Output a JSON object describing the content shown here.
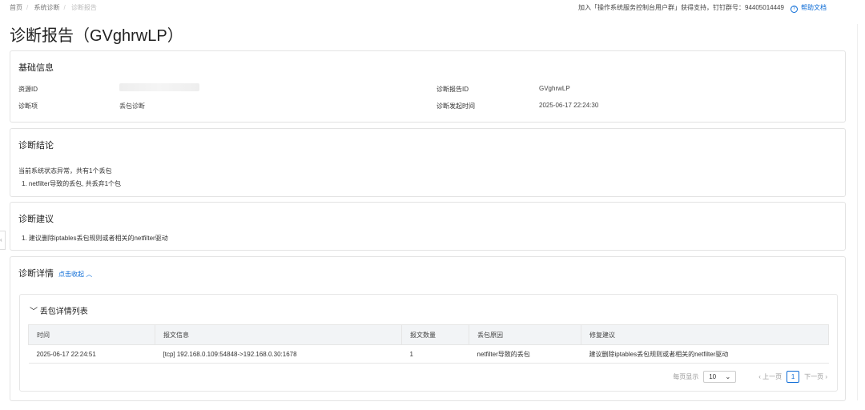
{
  "breadcrumb": [
    "首页",
    "系统诊断",
    "诊断报告"
  ],
  "support": {
    "text": "加入「操作系统服务控制台用户群」获得支持，钉钉群号：94405014449",
    "help": "帮助文档"
  },
  "title": "诊断报告（GVghrwLP）",
  "basic": {
    "title": "基础信息",
    "resource_id_label": "资源ID",
    "item_label": "诊断项",
    "item_value": "丢包诊断",
    "report_id_label": "诊断报告ID",
    "report_id_value": "GVghrwLP",
    "time_label": "诊断发起时间",
    "time_value": "2025-06-17 22:24:30"
  },
  "conclusion": {
    "title": "诊断结论",
    "summary": "当前系统状态异常，共有1个丢包",
    "item": "1. netfilter导致的丢包, 共丢弃1个包"
  },
  "advice": {
    "title": "诊断建议",
    "item": "1. 建议删除iptables丢包规则或者相关的netfilter驱动"
  },
  "details": {
    "title": "诊断详情",
    "toggle": "点击收起",
    "list_title": "丢包详情列表",
    "columns": [
      "时间",
      "报文信息",
      "报文数量",
      "丢包原因",
      "修复建议"
    ],
    "rows": [
      [
        "2025-06-17 22:24:51",
        "[tcp] 192.168.0.109:54848->192.168.0.30:1678",
        "1",
        "netfilter导致的丢包",
        "建议删除iptables丢包规则或者相关的netfilter驱动"
      ]
    ],
    "pager": {
      "page_size_label": "每页显示",
      "page_size": "10",
      "prev": "上一页",
      "page": "1",
      "next": "下一页"
    }
  }
}
